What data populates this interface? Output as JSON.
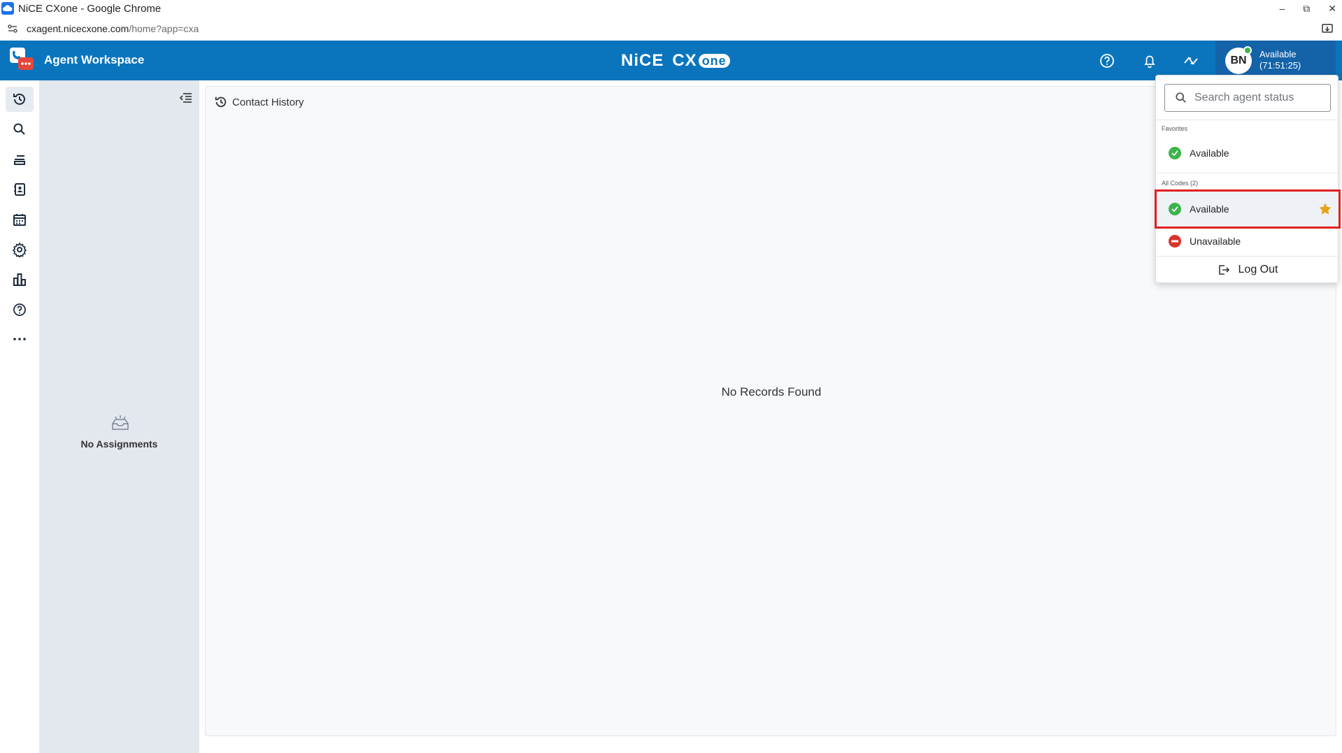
{
  "browser": {
    "window_title": "NiCE CXone - Google Chrome",
    "url_host": "cxagent.nicecxone.com",
    "url_path": "/home?app=cxa",
    "controls": [
      "–",
      "⧉",
      "✕"
    ]
  },
  "header": {
    "workspace_title": "Agent Workspace",
    "brand_nice": "NiCE",
    "brand_cx": "CX",
    "brand_one": "one",
    "agent_initials": "BN",
    "agent_status": "Available",
    "agent_timer": "(71:51:25)",
    "accent_color": "#0a75bd"
  },
  "rail": {
    "items": [
      {
        "name": "history-icon",
        "active": true
      },
      {
        "name": "search-icon",
        "active": false
      },
      {
        "name": "queue-icon",
        "active": false
      },
      {
        "name": "directory-icon",
        "active": false
      },
      {
        "name": "calendar-icon",
        "active": false
      },
      {
        "name": "settings-icon",
        "active": false
      },
      {
        "name": "reports-icon",
        "active": false
      },
      {
        "name": "help-icon",
        "active": false
      },
      {
        "name": "more-icon",
        "active": false
      }
    ]
  },
  "assignments": {
    "empty_text": "No Assignments"
  },
  "main": {
    "title": "Contact History",
    "empty_text": "No Records Found"
  },
  "status_menu": {
    "search_placeholder": "Search agent status",
    "favorites_label": "Favorites",
    "favorites": [
      {
        "label": "Available",
        "state": "available"
      }
    ],
    "all_codes_label": "All Codes (2)",
    "all_codes": [
      {
        "label": "Available",
        "state": "available",
        "favorite": true,
        "highlighted": true
      },
      {
        "label": "Unavailable",
        "state": "unavailable",
        "favorite": false,
        "highlighted": false
      }
    ],
    "logout_label": "Log Out",
    "colors": {
      "available": "#3bb54a",
      "unavailable": "#d9342b",
      "star": "#e8a317",
      "highlight": "#e02020"
    }
  }
}
